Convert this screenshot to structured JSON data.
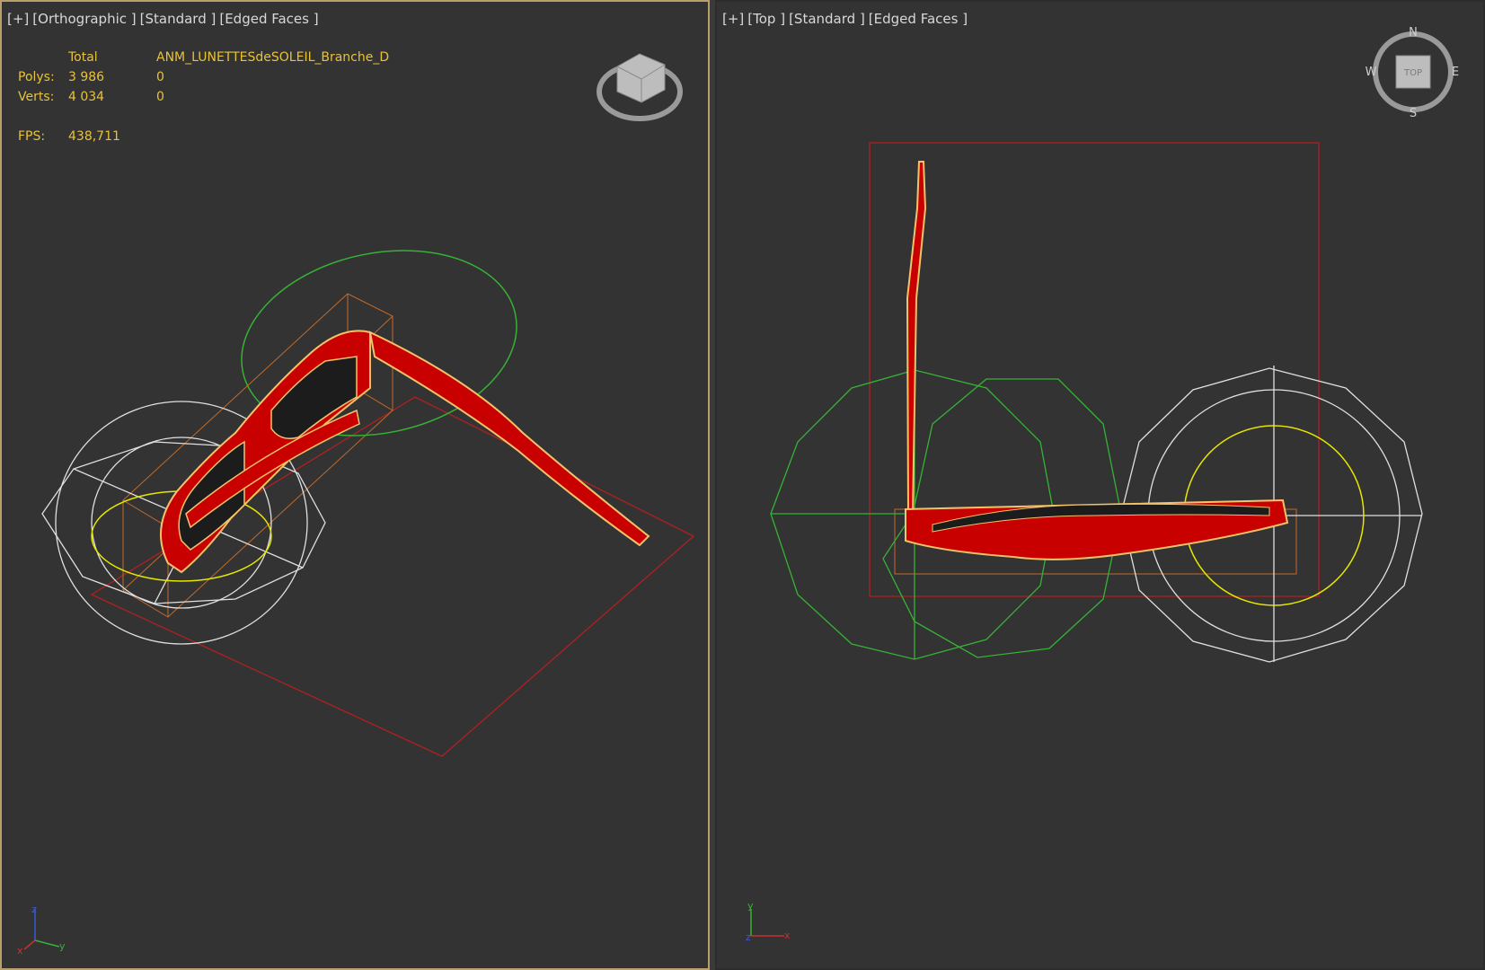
{
  "left_viewport": {
    "label": {
      "plus": "[+]",
      "view": "[Orthographic ]",
      "shading": "[Standard ]",
      "mode": "[Edged Faces ]"
    },
    "stats": {
      "header_total": "Total",
      "header_object": "ANM_LUNETTESdeSOLEIL_Branche_D",
      "polys_label": "Polys:",
      "polys_total": "3 986",
      "polys_object": "0",
      "verts_label": "Verts:",
      "verts_total": "4 034",
      "verts_object": "0",
      "fps_label": "FPS:",
      "fps_value": "438,711"
    },
    "viewcube_icon": "viewcube-icon",
    "axis_tripod": {
      "z": "z",
      "y": "y",
      "x": "x"
    }
  },
  "right_viewport": {
    "label": {
      "plus": "[+]",
      "view": "[Top ]",
      "shading": "[Standard ]",
      "mode": "[Edged Faces ]"
    },
    "viewcube": {
      "face": "TOP",
      "n": "N",
      "s": "S",
      "e": "E",
      "w": "W"
    },
    "axis_tripod": {
      "y": "y",
      "x": "x",
      "z": "z"
    }
  },
  "colors": {
    "viewport_bg": "#333333",
    "active_border": "#b9a06a",
    "stats_text": "#e8c23a",
    "wire_red": "#c80000",
    "wire_yellow": "#f2c36b",
    "gizmo_green": "#36b236",
    "gizmo_white": "#e0e0e0",
    "gizmo_yellow": "#e6e600",
    "bbox_red": "#b02020",
    "bbox_orange": "#c06a2a"
  }
}
